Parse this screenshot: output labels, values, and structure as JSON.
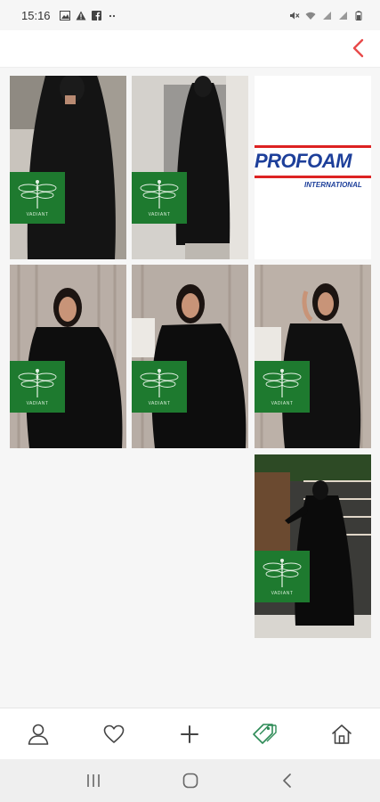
{
  "status_bar": {
    "time": "15:16",
    "left_icons": [
      "image-icon",
      "warning-icon",
      "facebook-icon",
      "more-dots-icon"
    ],
    "right_icons": [
      "mute-icon",
      "wifi-icon",
      "signal-icon",
      "signal-icon",
      "battery-icon"
    ]
  },
  "header": {
    "back_icon": "chevron-left-icon",
    "accent_color": "#e84a4a"
  },
  "grid": {
    "tiles": [
      {
        "type": "photo",
        "subject": "black abaya model",
        "badge": "VADIANT"
      },
      {
        "type": "photo",
        "subject": "black abaya model",
        "badge": "VADIANT"
      },
      {
        "type": "logo",
        "logo_text": "PROFOAM",
        "logo_subtext": "INTERNATIONAL"
      },
      {
        "type": "photo",
        "subject": "black abaya model",
        "badge": "VADIANT"
      },
      {
        "type": "photo",
        "subject": "black abaya model",
        "badge": "VADIANT"
      },
      {
        "type": "photo",
        "subject": "black abaya model",
        "badge": "VADIANT"
      },
      {
        "type": "photo",
        "subject": "black abaya model full length",
        "badge": "VADIANT"
      }
    ]
  },
  "bottom_nav": {
    "items": [
      {
        "icon": "profile-icon",
        "active": false
      },
      {
        "icon": "heart-icon",
        "active": false
      },
      {
        "icon": "plus-icon",
        "active": false
      },
      {
        "icon": "tags-icon",
        "active": true
      },
      {
        "icon": "home-icon",
        "active": false
      }
    ],
    "active_color": "#2e8b57"
  },
  "system_nav": {
    "items": [
      "recents-icon",
      "home-circle-icon",
      "back-icon"
    ]
  }
}
